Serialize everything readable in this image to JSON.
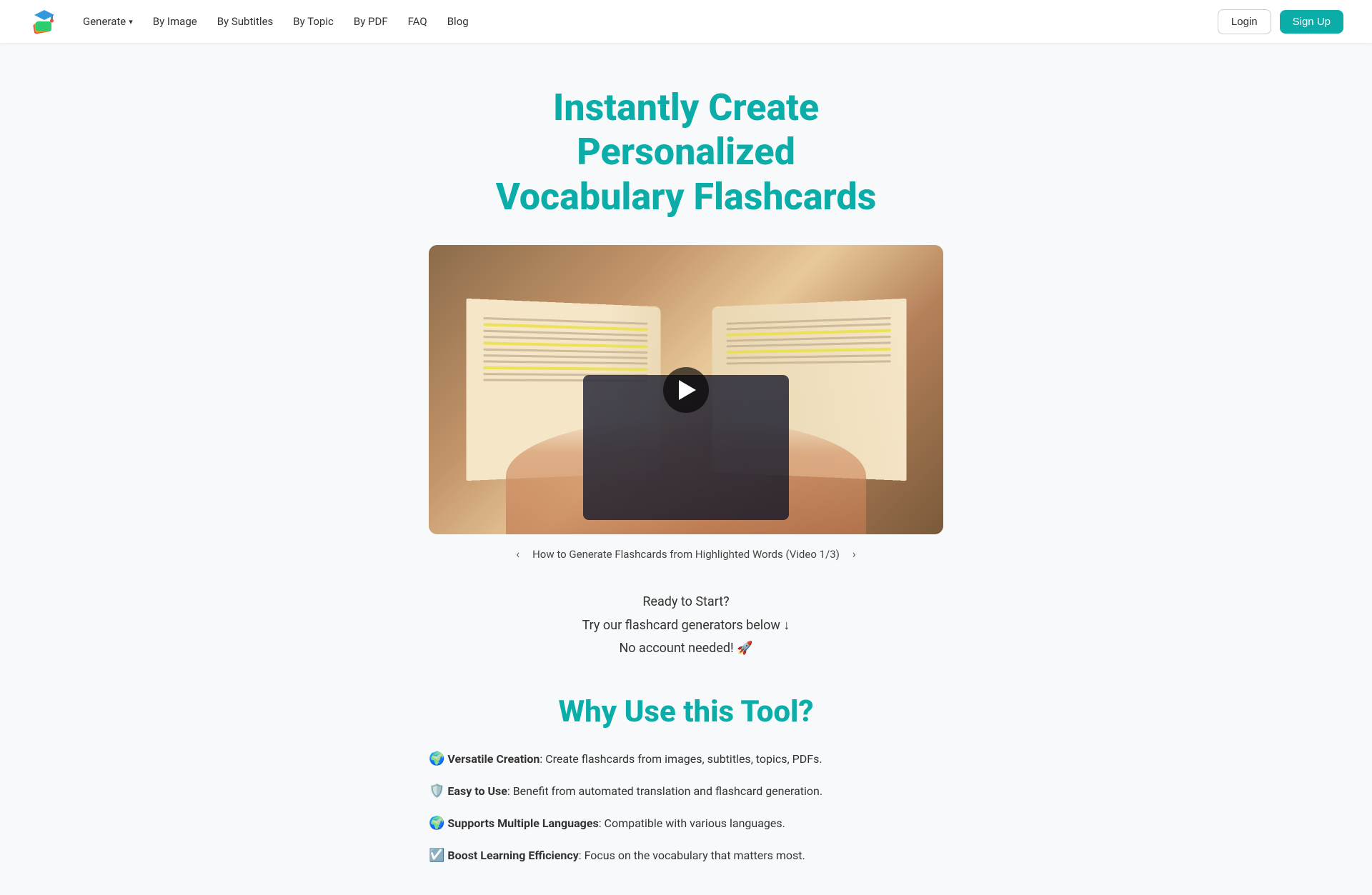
{
  "navbar": {
    "logo_alt": "Vocab Flashcard App Logo",
    "generate_label": "Generate",
    "by_image_label": "By Image",
    "by_subtitles_label": "By Subtitles",
    "by_topic_label": "By Topic",
    "by_pdf_label": "By PDF",
    "faq_label": "FAQ",
    "blog_label": "Blog",
    "login_label": "Login",
    "signup_label": "Sign Up"
  },
  "hero": {
    "title_line1": "Instantly Create",
    "title_line2": "Personalized",
    "title_line3": "Vocabulary Flashcards"
  },
  "video": {
    "caption": "How to Generate Flashcards from Highlighted Words (Video 1/3)"
  },
  "ready_section": {
    "line1": "Ready to Start?",
    "line2": "Try our flashcard generators below ↓",
    "line3": "No account needed! 🚀"
  },
  "why_section": {
    "title": "Why Use this Tool?",
    "features": [
      {
        "icon": "🌍",
        "title": "Versatile Creation",
        "description": ": Create flashcards from images, subtitles, topics, PDFs."
      },
      {
        "icon": "🛡️",
        "title": "Easy to Use",
        "description": ": Benefit from automated translation and flashcard generation."
      },
      {
        "icon": "🌍",
        "title": "Supports Multiple Languages",
        "description": ": Compatible with various languages."
      },
      {
        "icon": "☑️",
        "title": "Boost Learning Efficiency",
        "description": ": Focus on the vocabulary that matters most."
      }
    ]
  }
}
